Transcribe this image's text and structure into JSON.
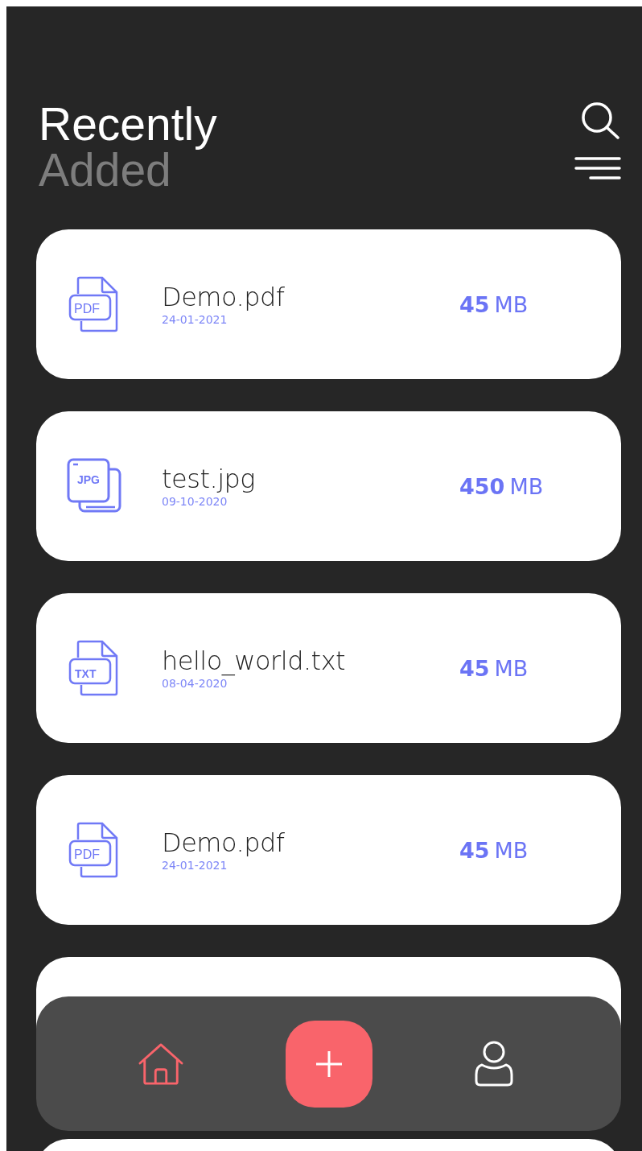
{
  "header": {
    "title_line_1": "Recently",
    "title_line_2": "Added"
  },
  "files": [
    {
      "kind": "pdf",
      "type_label": "PDF",
      "name": "Demo.pdf",
      "date": "24-01-2021",
      "size_value": "45",
      "size_unit": "MB"
    },
    {
      "kind": "jpg",
      "type_label": "JPG",
      "name": "test.jpg",
      "date": "09-10-2020",
      "size_value": "450",
      "size_unit": "MB"
    },
    {
      "kind": "txt",
      "type_label": "TXT",
      "name": "hello_world.txt",
      "date": "08-04-2020",
      "size_value": "45",
      "size_unit": "MB"
    },
    {
      "kind": "pdf",
      "type_label": "PDF",
      "name": "Demo.pdf",
      "date": "24-01-2021",
      "size_value": "45",
      "size_unit": "MB"
    }
  ],
  "nav": [
    {
      "kind": "home",
      "selected": true
    },
    {
      "kind": "add"
    },
    {
      "kind": "profile",
      "selected": false
    }
  ]
}
